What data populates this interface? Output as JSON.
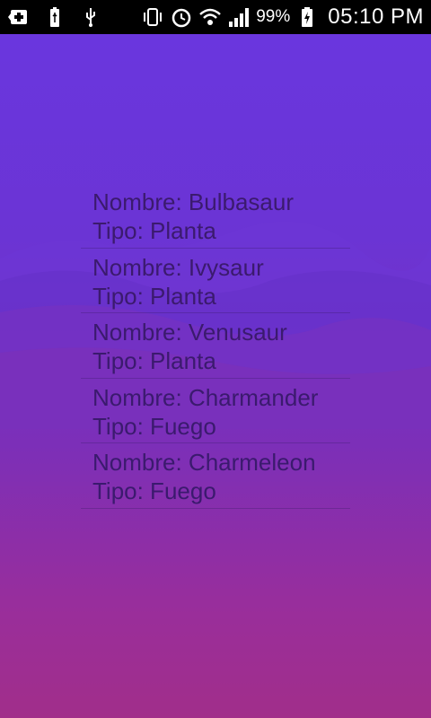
{
  "status_bar": {
    "icons_left": [
      "first-aid-icon",
      "usb-battery-icon",
      "usb-icon"
    ],
    "icons_right": [
      "vibrate-icon",
      "alarm-icon",
      "wifi-icon",
      "signal-icon",
      "battery-charging-icon"
    ],
    "battery_percent": "99%",
    "time": "05:10 PM"
  },
  "pokemon_list": [
    {
      "name_line": "Nombre: Bulbasaur",
      "type_line": "Tipo: Planta"
    },
    {
      "name_line": "Nombre: Ivysaur",
      "type_line": "Tipo: Planta"
    },
    {
      "name_line": "Nombre: Venusaur",
      "type_line": "Tipo: Planta"
    },
    {
      "name_line": "Nombre: Charmander",
      "type_line": "Tipo: Fuego"
    },
    {
      "name_line": "Nombre: Charmeleon",
      "type_line": "Tipo: Fuego"
    }
  ],
  "colors": {
    "background_top": "#6a36de",
    "background_bottom": "#a12e8a",
    "text": "#3b1a6e"
  }
}
